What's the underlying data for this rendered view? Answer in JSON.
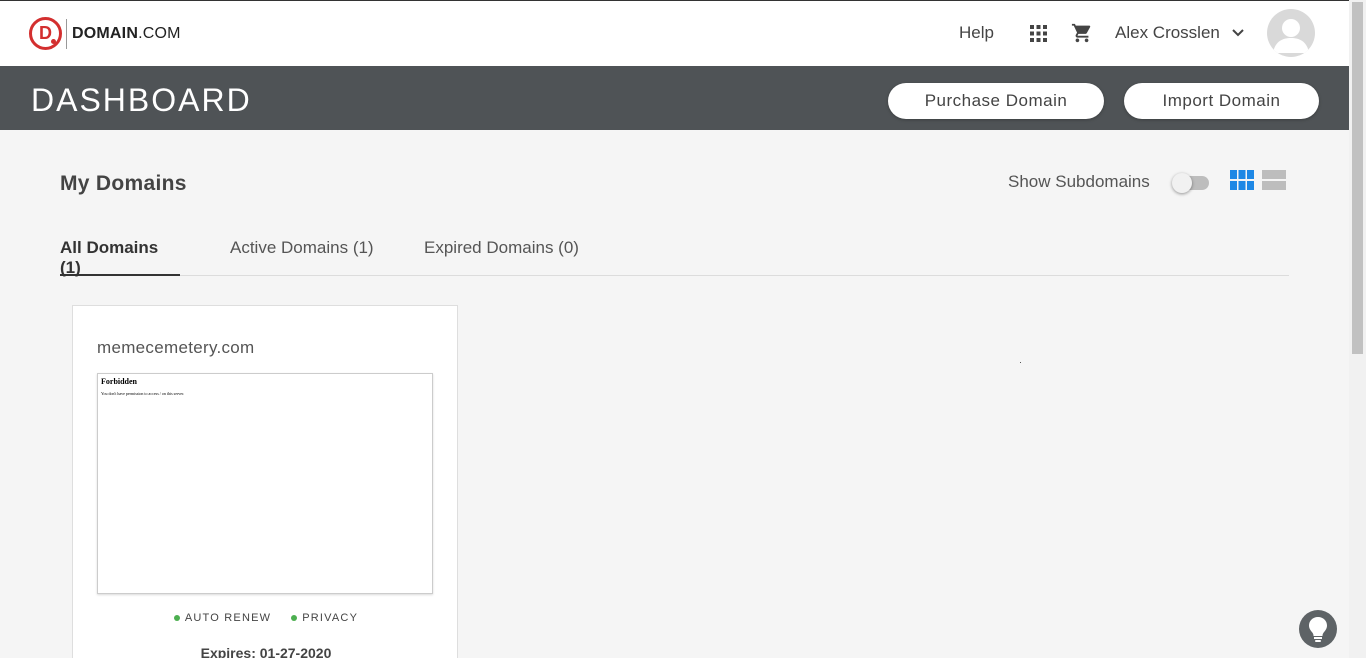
{
  "header": {
    "logo_text_bold": "DOMAIN",
    "logo_text_rest": ".COM",
    "logo_letter": "D",
    "help_label": "Help",
    "user_name": "Alex Crosslen"
  },
  "dashboard": {
    "title": "DASHBOARD",
    "purchase_label": "Purchase Domain",
    "import_label": "Import Domain"
  },
  "domains": {
    "title": "My Domains",
    "show_subdomains_label": "Show Subdomains",
    "show_subdomains_on": false,
    "tabs": [
      {
        "label": "All Domains (1)",
        "selected": true
      },
      {
        "label": "Active Domains (1)",
        "selected": false
      },
      {
        "label": "Expired Domains (0)",
        "selected": false
      }
    ],
    "cards": [
      {
        "name": "memecemetery.com",
        "preview_title": "Forbidden",
        "preview_text": "You don't have permission to access / on this server.",
        "statuses": [
          "AUTO RENEW",
          "PRIVACY"
        ],
        "expires": "Expires: 01-27-2020"
      }
    ]
  },
  "colors": {
    "brand_red": "#d32f2f",
    "dash_bar": "#4f5356",
    "accent_blue": "#1e88e5",
    "status_green": "#4caf50"
  },
  "icons": {
    "apps": "apps-grid-icon",
    "cart": "shopping-cart-icon",
    "chevron": "chevron-down-icon",
    "grid_view": "grid-view-icon",
    "list_view": "list-view-icon",
    "help": "lightbulb-icon"
  }
}
